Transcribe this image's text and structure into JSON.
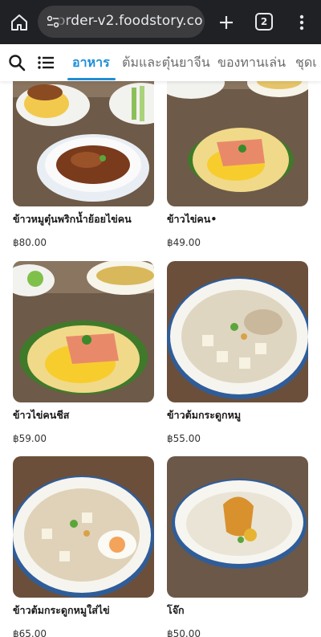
{
  "browser": {
    "url": "order-v2.foodstory.co",
    "tab_count": "2"
  },
  "categories": {
    "tabs": [
      {
        "label": "อาหาร",
        "active": true
      },
      {
        "label": "ต้มและตุ๋นยาจีน",
        "active": false
      },
      {
        "label": "ของทานเล่น",
        "active": false
      },
      {
        "label": "ชุดเ",
        "active": false
      }
    ]
  },
  "colors": {
    "accent": "#1f8fd6",
    "browser_bg": "#202124"
  },
  "products": [
    {
      "name": "ข้าวหมูตุ๋นพริกน้ำย้อยไข่คน",
      "price": "฿80.00"
    },
    {
      "name": "ข้าวไข่คน•",
      "price": "฿49.00"
    },
    {
      "name": "ข้าวไข่คนชีส",
      "price": "฿59.00"
    },
    {
      "name": "ข้าวต้มกระดูกหมู",
      "price": "฿55.00"
    },
    {
      "name": "ข้าวต้มกระดูกหมูใส่ไข่",
      "price": "฿65.00"
    },
    {
      "name": "โจ๊ก",
      "price": "฿50.00"
    }
  ]
}
